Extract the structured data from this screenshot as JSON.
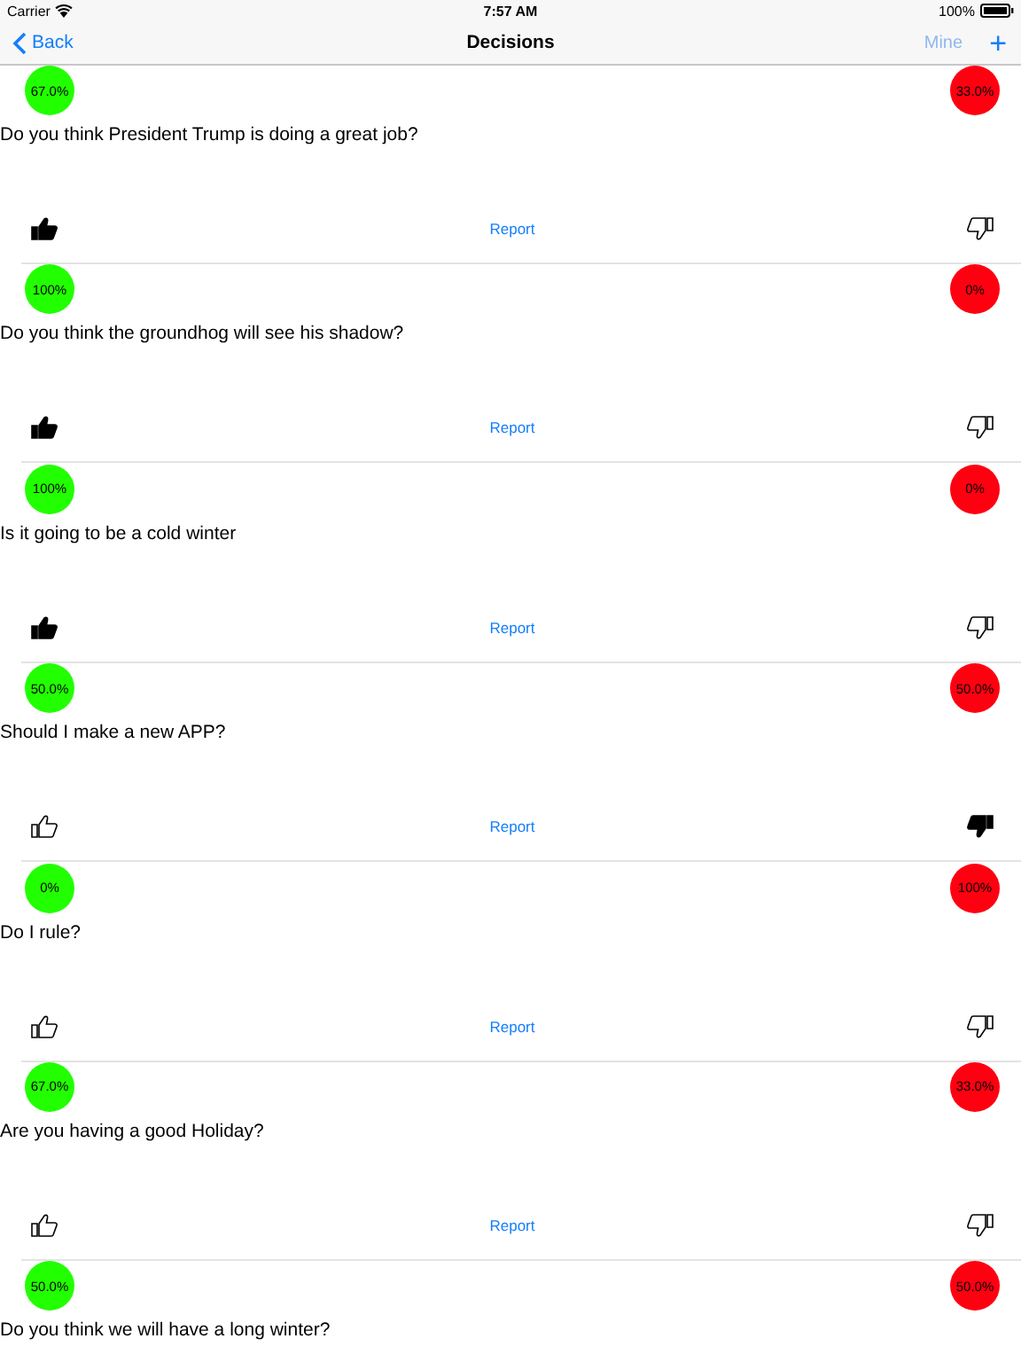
{
  "status_bar": {
    "carrier": "Carrier",
    "time": "7:57 AM",
    "battery": "100%"
  },
  "nav": {
    "back": "Back",
    "title": "Decisions",
    "mine": {
      "label": "Mine",
      "disabled": true
    },
    "add": "+"
  },
  "decisions": [
    {
      "yes": "67.0%",
      "no": "33.0%",
      "question": "Do you think President Trump is doing a great job?",
      "liked": true,
      "disliked": false,
      "report": "Report"
    },
    {
      "yes": "100%",
      "no": "0%",
      "question": "Do you think the groundhog will see his shadow?",
      "liked": true,
      "disliked": false,
      "report": "Report"
    },
    {
      "yes": "100%",
      "no": "0%",
      "question": "Is it going to be a cold winter",
      "liked": true,
      "disliked": false,
      "report": "Report"
    },
    {
      "yes": "50.0%",
      "no": "50.0%",
      "question": "Should I make a new APP?",
      "liked": false,
      "disliked": true,
      "report": "Report"
    },
    {
      "yes": "0%",
      "no": "100%",
      "question": "Do I rule?",
      "liked": false,
      "disliked": false,
      "report": "Report"
    },
    {
      "yes": "67.0%",
      "no": "33.0%",
      "question": "Are you having a good Holiday?",
      "liked": false,
      "disliked": false,
      "report": "Report"
    },
    {
      "yes": "50.0%",
      "no": "50.0%",
      "question": "Do you think we will have a long winter?"
    }
  ]
}
